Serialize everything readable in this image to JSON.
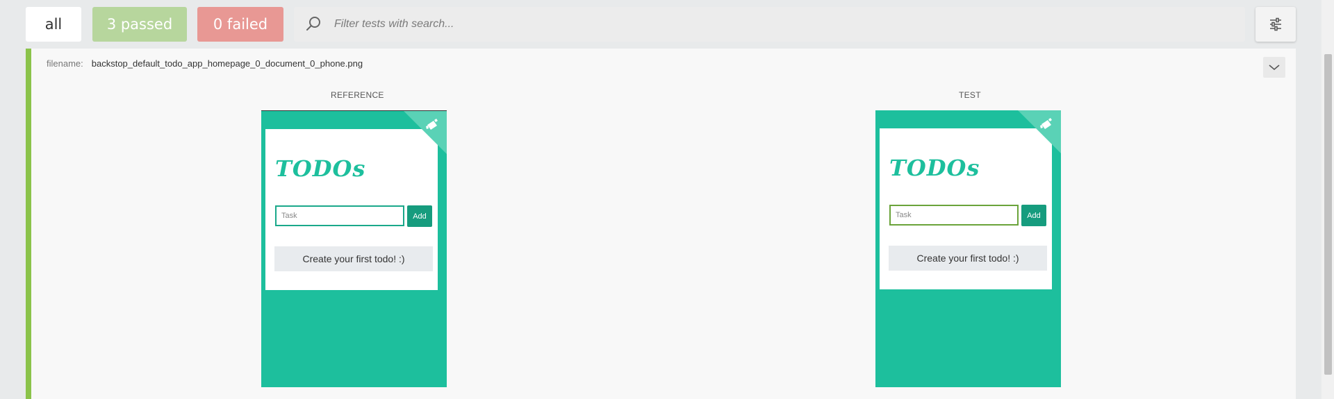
{
  "filters": {
    "all_label": "all",
    "passed_label": "3 passed",
    "failed_label": "0 failed"
  },
  "search": {
    "placeholder": "Filter tests with search..."
  },
  "report": {
    "filename_label": "filename:",
    "filename_value": "backstop_default_todo_app_homepage_0_document_0_phone.png",
    "reference_label": "REFERENCE",
    "test_label": "TEST"
  },
  "app_screenshot": {
    "title": "TODOs",
    "task_placeholder": "Task",
    "add_label": "Add",
    "empty_message": "Create your first todo! :)"
  },
  "colors": {
    "passed": "#b7d69d",
    "failed": "#e89894",
    "accent": "#8bc34a",
    "app_teal": "#1dbf9d"
  },
  "icons": [
    "search-icon",
    "settings-sliders-icon",
    "chevron-down-icon",
    "ribbon-cup-icon"
  ]
}
